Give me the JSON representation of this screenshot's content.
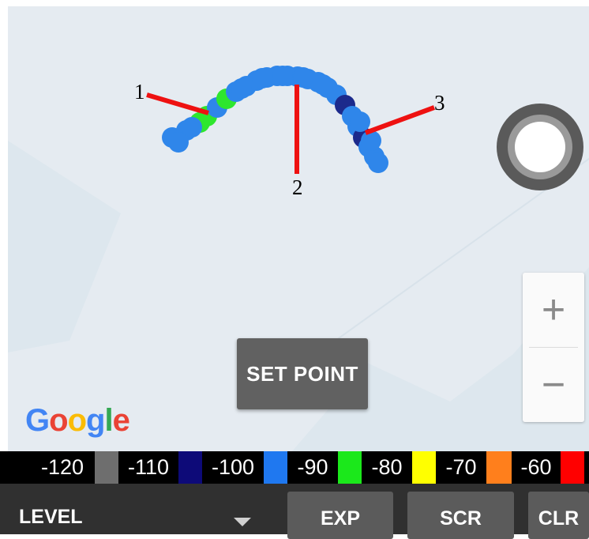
{
  "map": {
    "attribution": "Google",
    "zoom_in_label": "+",
    "zoom_out_label": "−",
    "set_point_label": "SET POINT"
  },
  "annotations": [
    {
      "label": "1"
    },
    {
      "label": "2"
    },
    {
      "label": "3"
    }
  ],
  "legend": [
    {
      "label": "-120",
      "color": "#6e6e6e"
    },
    {
      "label": "-110",
      "color": "#0d0a78"
    },
    {
      "label": "-100",
      "color": "#1f78f0"
    },
    {
      "label": "-90",
      "color": "#1be81b"
    },
    {
      "label": "-80",
      "color": "#ffff00"
    },
    {
      "label": "-70",
      "color": "#ff7f1c"
    },
    {
      "label": "-60",
      "color": "#ff0000"
    }
  ],
  "toolbar": {
    "level_label": "LEVEL",
    "exp_label": "EXP",
    "scr_label": "SCR",
    "clr_label": "CLR"
  },
  "colors": {
    "track_blue": "#2f86ea",
    "track_green": "#2ee62e",
    "track_dark": "#1c2a8c",
    "annotation_line": "#ee1111",
    "map_bg": "#e5ebf1"
  }
}
